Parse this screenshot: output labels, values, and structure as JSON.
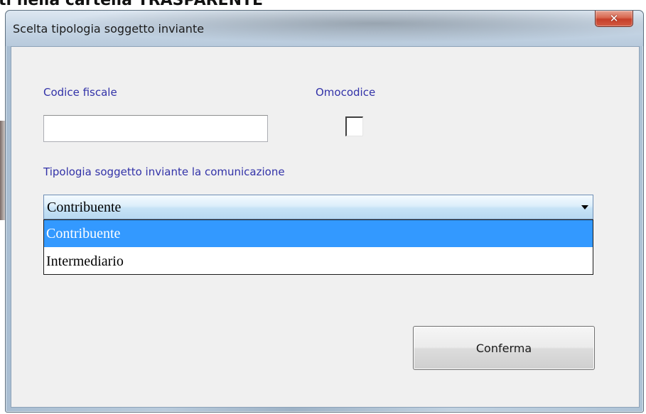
{
  "page_caption": "ti nella cartella TRASPARENTE",
  "dialog": {
    "title": "Scelta tipologia soggetto inviante",
    "close_icon": "close-x-icon",
    "fields": {
      "codice_fiscale": {
        "label": "Codice fiscale",
        "value": ""
      },
      "omocodice": {
        "label": "Omocodice",
        "checked": false
      }
    },
    "tipologia": {
      "label": "Tipologia soggetto inviante la comunicazione",
      "selected_value": "Contribuente",
      "options": [
        "Contribuente",
        "Intermediario"
      ],
      "highlighted_index": 0
    },
    "confirm_label": "Conferma"
  },
  "colors": {
    "label_text": "#3232a8",
    "selection_highlight": "#3399ff",
    "close_button": "#c6402a"
  }
}
